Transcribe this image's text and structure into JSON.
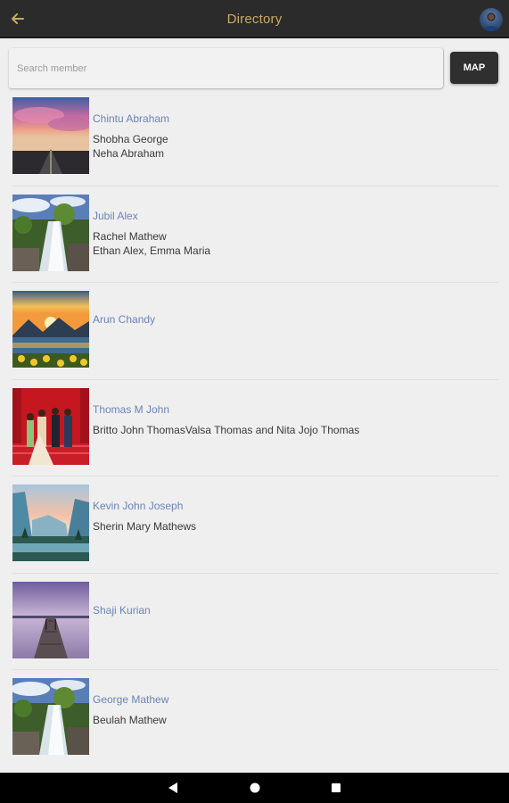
{
  "appbar": {
    "title": "Directory",
    "back_icon": "arrow-left-icon",
    "avatar_icon": "user-avatar"
  },
  "search": {
    "placeholder": "Search member",
    "value": ""
  },
  "map_button": {
    "label": "MAP"
  },
  "colors": {
    "appbar_bg": "#2b2b2b",
    "title_gold": "#c9a866",
    "name_link": "#6b84b8",
    "page_bg": "#efefef"
  },
  "members": [
    {
      "name": "Chintu Abraham",
      "lines": [
        "Shobha George",
        "Neha Abraham"
      ],
      "thumbnail": "sunset-road-photo"
    },
    {
      "name": "Jubil Alex",
      "lines": [
        "Rachel Mathew",
        "Ethan Alex, Emma Maria"
      ],
      "thumbnail": "waterfall-photo"
    },
    {
      "name": "Arun Chandy",
      "lines": [],
      "thumbnail": "mountain-lake-sunflowers-photo"
    },
    {
      "name": "Thomas M John",
      "lines": [
        "Britto John ThomasValsa Thomas and Nita Jojo Thomas"
      ],
      "thumbnail": "family-wedding-photo"
    },
    {
      "name": "Kevin John Joseph",
      "lines": [
        "Sherin Mary Mathews"
      ],
      "thumbnail": "valley-river-photo"
    },
    {
      "name": "Shaji Kurian",
      "lines": [],
      "thumbnail": "lake-pier-photo"
    },
    {
      "name": "George Mathew",
      "lines": [
        "Beulah Mathew"
      ],
      "thumbnail": "waterfall-photo"
    }
  ],
  "system_nav": {
    "back_icon": "triangle-back-icon",
    "home_icon": "circle-home-icon",
    "recents_icon": "square-recents-icon"
  }
}
